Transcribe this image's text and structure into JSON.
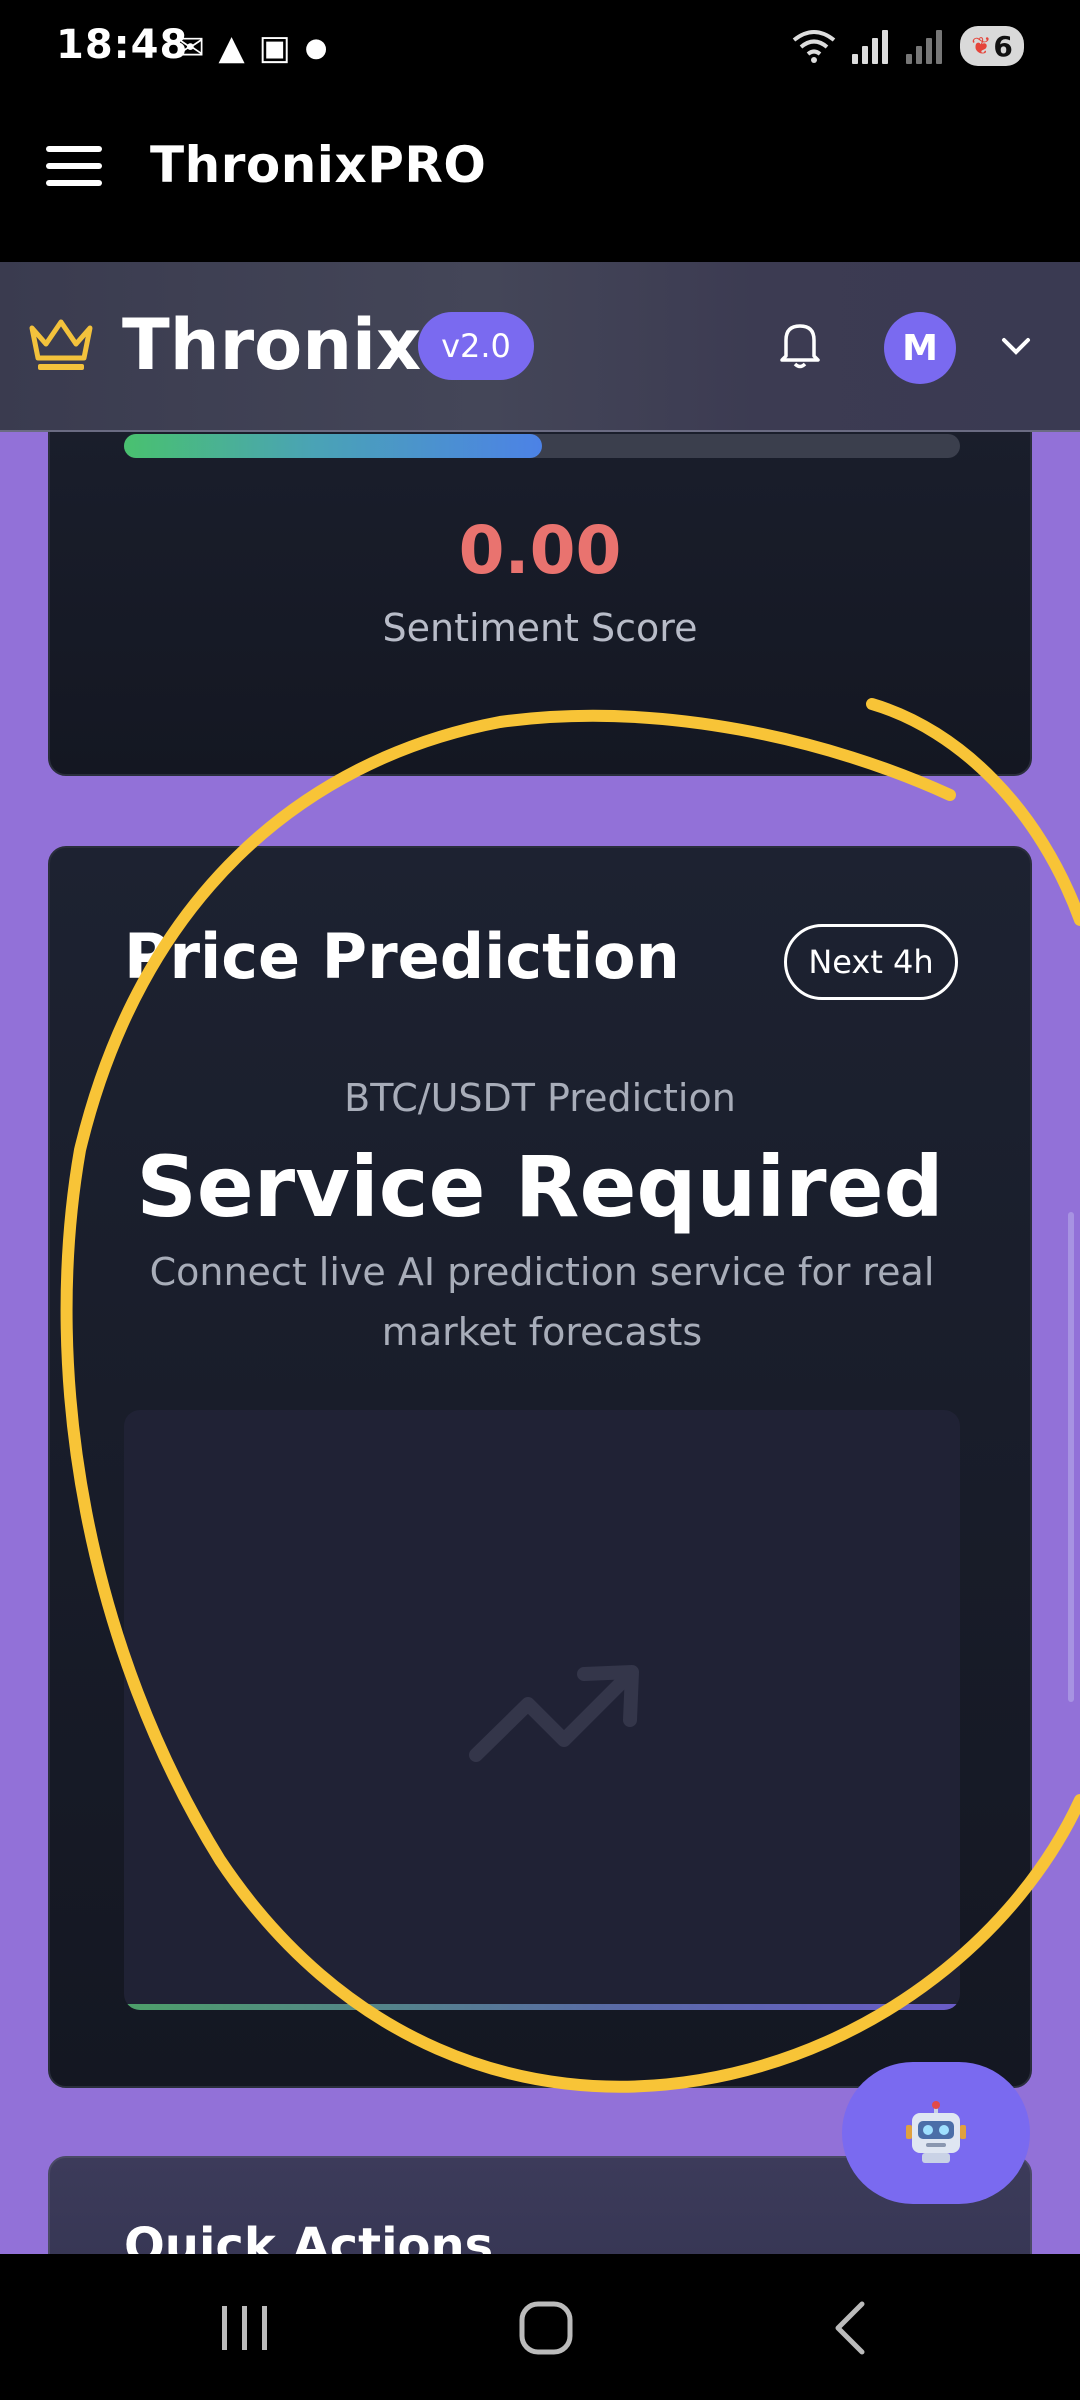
{
  "status_bar": {
    "time": "18:48",
    "left_icons": [
      "gmail-icon",
      "app-icon",
      "screenshot-icon",
      "dot-icon"
    ],
    "right_icons": [
      "wifi-icon",
      "signal-icon",
      "signal-icon-2"
    ],
    "battery_level": "6"
  },
  "app_bar": {
    "title": "ThronixPRO"
  },
  "header": {
    "brand": "Thronix",
    "version": "v2.0",
    "avatar_initial": "M"
  },
  "sentiment": {
    "progress_percent": 50,
    "score": "0.00",
    "label": "Sentiment Score"
  },
  "prediction": {
    "title": "Price Prediction",
    "range_badge": "Next 4h",
    "pair": "BTC/USDT Prediction",
    "status": "Service Required",
    "description": "Connect live AI prediction service for real market forecasts"
  },
  "quick_actions": {
    "title": "Quick Actions"
  },
  "colors": {
    "accent": "#7a6af0",
    "page_bg": "#9271d8",
    "score": "#e9736f",
    "annotation": "#f8c437"
  }
}
